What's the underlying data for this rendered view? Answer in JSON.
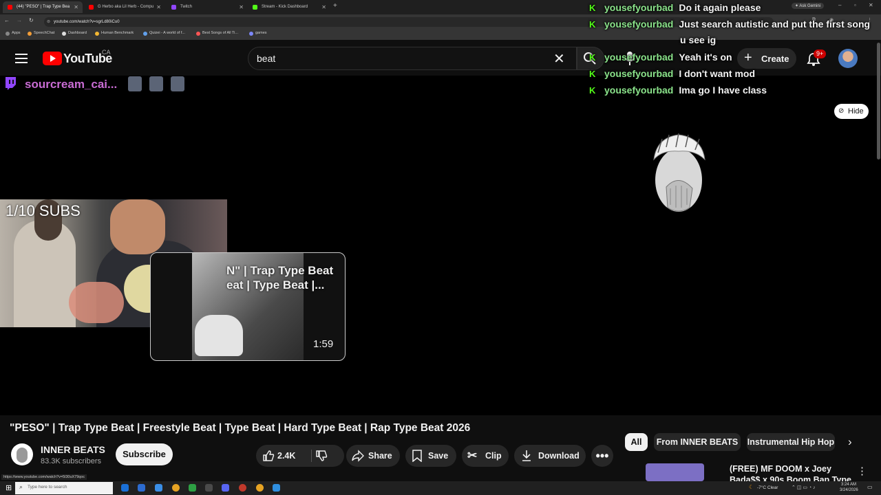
{
  "browser": {
    "tabs": [
      {
        "label": "(44) \"PESO\" | Trap Type Bea",
        "color": "#ff0000",
        "active": true
      },
      {
        "label": "G Herbo aka Lil Herb - Compu",
        "color": "#ff0000",
        "active": false
      },
      {
        "label": "Twitch",
        "color": "#9146ff",
        "active": false
      },
      {
        "label": "Stream - Kick Dashboard",
        "color": "#53fc18",
        "active": false
      }
    ],
    "url": "youtube.com/watch?v=sgrLd80iCu0",
    "bookmarks": [
      {
        "label": "Apps",
        "color": "#888888"
      },
      {
        "label": "SpeechChat",
        "color": "#f29d38"
      },
      {
        "label": "Dashboard",
        "color": "#dddddd"
      },
      {
        "label": "Human Benchmark",
        "color": "#f2b632"
      },
      {
        "label": "Quizei - A world of f...",
        "color": "#62a0ea"
      },
      {
        "label": "Best Songs of All Ti...",
        "color": "#ff5555"
      },
      {
        "label": "games",
        "color": "#7c87f8"
      }
    ],
    "ask_gemini": "Ask Gemini",
    "status_url": "https://www.youtube.com/watch?v=5l30uX79qoc"
  },
  "youtube": {
    "logo_text": "YouTube",
    "country": "CA",
    "search_value": "beat",
    "create_label": "Create",
    "notification_count": "9+"
  },
  "chat": [
    {
      "user": "yousefyourbad",
      "msg": "Do it again please"
    },
    {
      "user": "yousefyourbad",
      "msg": "Just search autistic and put the first song"
    },
    {
      "user": "",
      "msg": "u see ig"
    },
    {
      "user": "yousefyourbad",
      "msg": "Yeah it's on"
    },
    {
      "user": "yousefyourbad",
      "msg": "I don't want mod"
    },
    {
      "user": "yousefyourbad",
      "msg": "Ima go I have class"
    }
  ],
  "stream_overlay": {
    "twitch_name": "sourcream_cai...",
    "subs_goal": "1/10 SUBS",
    "hide_label": "Hide"
  },
  "miniplayer": {
    "title_line1": "N\" | Trap Type Beat",
    "title_line2": "eat | Type Beat |...",
    "duration": "1:59"
  },
  "video": {
    "title": "\"PESO\" | Trap Type Beat | Freestyle Beat | Type Beat | Hard Type Beat | Rap Type Beat 2026",
    "channel_name": "INNER BEATS",
    "subscribers": "83.3K subscribers",
    "subscribe_label": "Subscribe",
    "likes": "2.4K",
    "share_label": "Share",
    "save_label": "Save",
    "clip_label": "Clip",
    "download_label": "Download"
  },
  "chips": [
    "All",
    "From INNER BEATS",
    "Instrumental Hip Hop"
  ],
  "recommendation": {
    "title_line1": "(FREE) MF DOOM x Joey",
    "title_line2": "Bada$$ x 90s Boom Bap Type"
  },
  "taskbar": {
    "search_placeholder": "Type here to search",
    "weather": "-7°C  Clear",
    "time": "3:24 AM",
    "date": "3/24/2026"
  }
}
